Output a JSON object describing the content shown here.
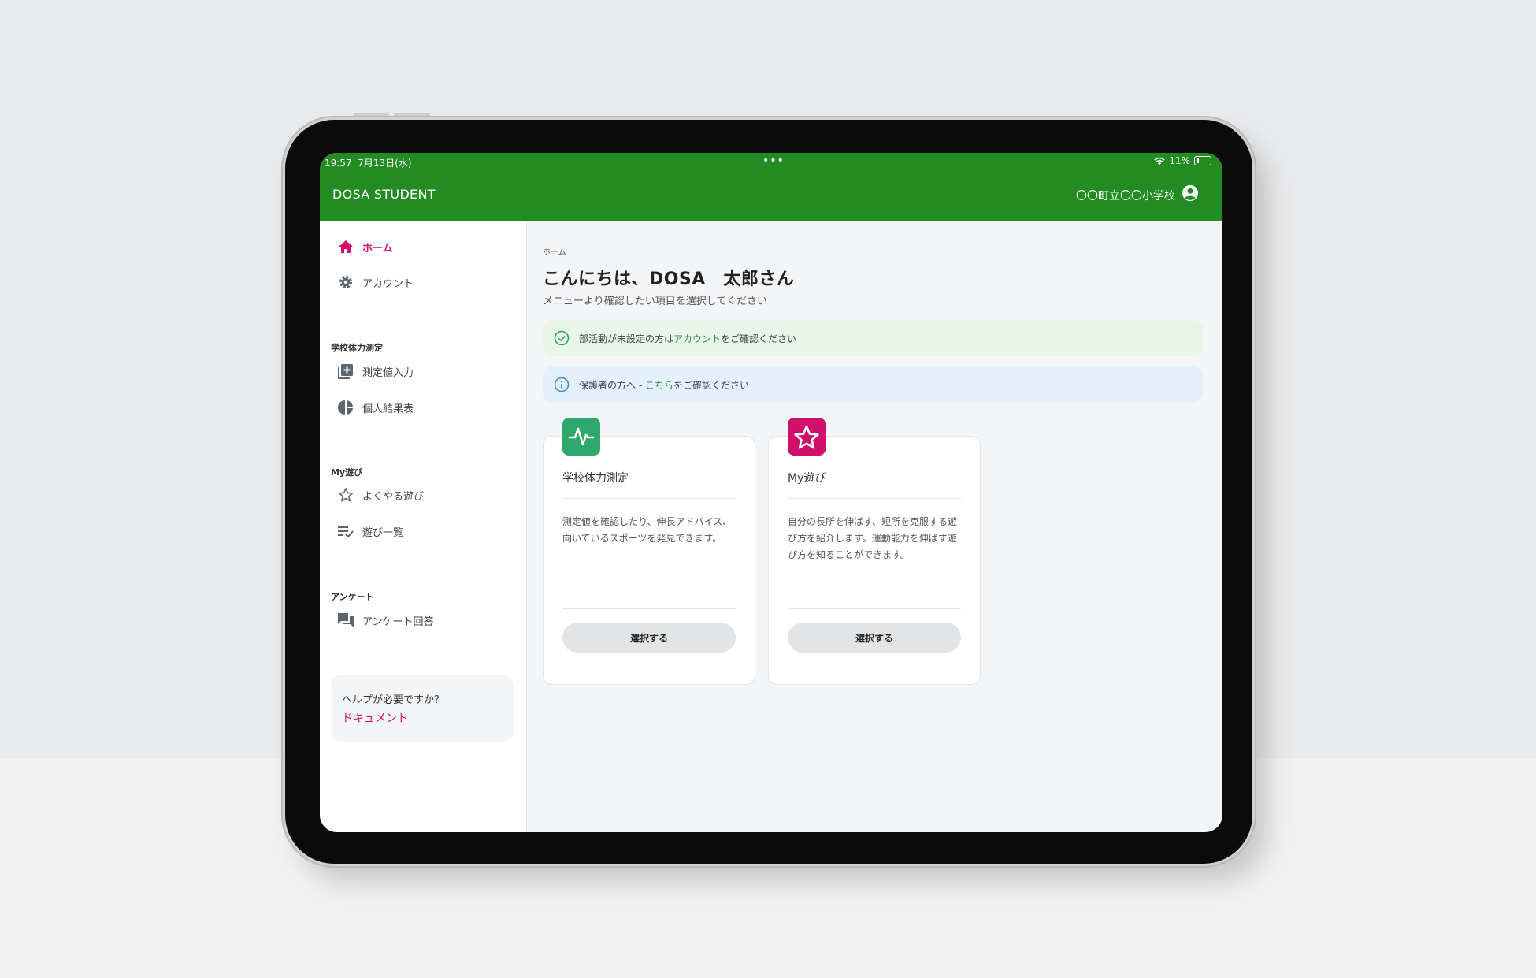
{
  "status": {
    "time": "19:57",
    "date": "7月13日(水)",
    "dots": "•••",
    "battery": "11%"
  },
  "appbar": {
    "brand": "DOSA STUDENT",
    "school": "〇〇町立〇〇小学校"
  },
  "sidebar": {
    "home": "ホーム",
    "account": "アカウント",
    "section_fitness": "学校体力測定",
    "measure_input": "測定値入力",
    "personal_results": "個人結果表",
    "section_play": "My遊び",
    "favorite_play": "よくやる遊び",
    "play_list": "遊び一覧",
    "section_survey": "アンケート",
    "survey_answer": "アンケート回答",
    "help_question": "ヘルプが必要ですか？",
    "help_doc": "ドキュメント"
  },
  "main": {
    "breadcrumb": "ホーム",
    "greeting": "こんにちは、DOSA　太郎さん",
    "subtitle": "メニューより確認したい項目を選択してください",
    "alert1": {
      "before": "部活動が未設定の方は",
      "link": "アカウント",
      "after": "をご確認ください"
    },
    "alert2": {
      "before": "保護者の方へ - ",
      "link": "こちら",
      "after": "をご確認ください"
    },
    "cards": [
      {
        "title": "学校体力測定",
        "desc": "測定値を確認したり、伸長アドバイス、向いているスポーツを発見できます。",
        "button": "選択する",
        "color": "#2fa86e"
      },
      {
        "title": "My遊び",
        "desc": "自分の長所を伸ばす、短所を克服する遊び方を紹介します。運動能力を伸ばす遊び方を知ることができます。",
        "button": "選択する",
        "color": "#d0106b"
      }
    ]
  },
  "colors": {
    "appbar": "#228b22",
    "accent": "#d0106b"
  }
}
